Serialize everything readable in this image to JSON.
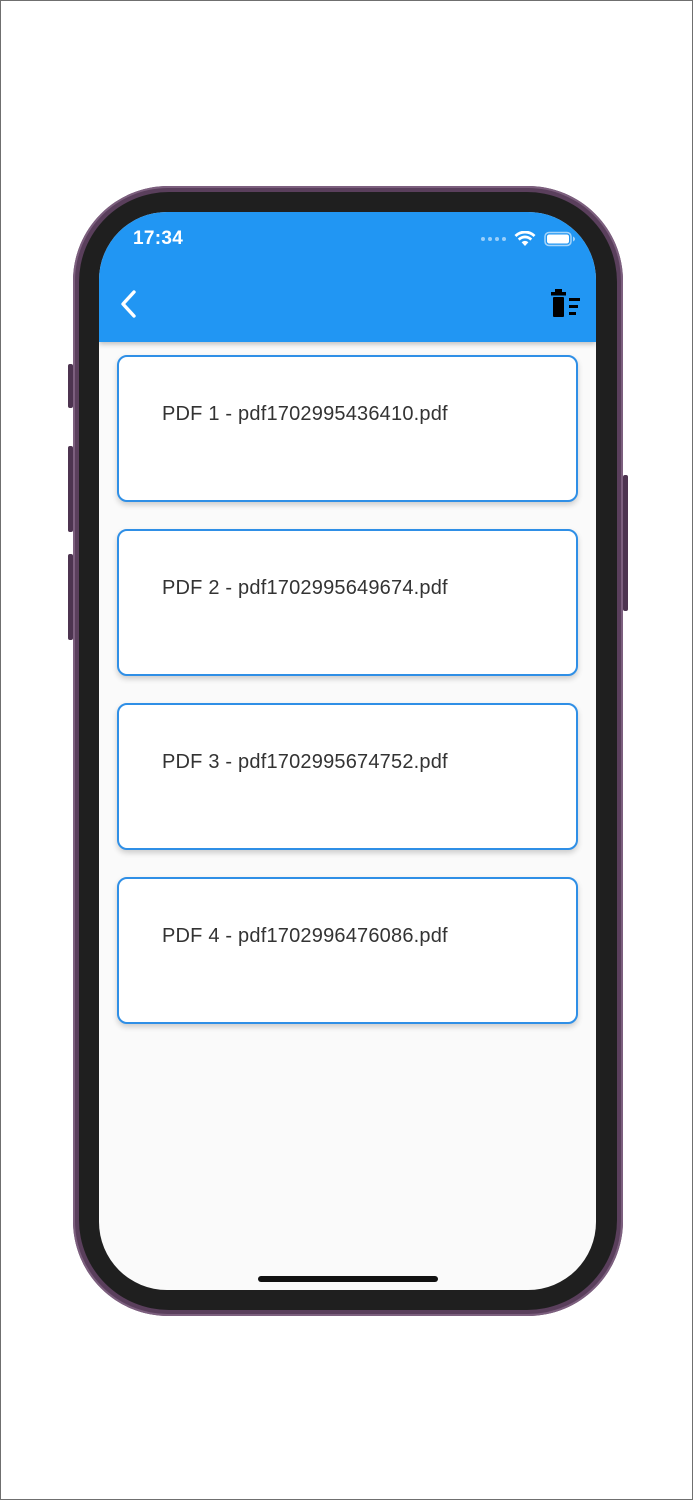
{
  "status_bar": {
    "time": "17:34"
  },
  "app_bar": {
    "back_icon": "chevron-left-icon",
    "action_icon": "delete-sweep-icon",
    "background_color": "#2196f3"
  },
  "pdf_list": [
    {
      "label": "PDF 1 - pdf1702995436410.pdf"
    },
    {
      "label": "PDF 2 - pdf1702995649674.pdf"
    },
    {
      "label": "PDF 3 - pdf1702995674752.pdf"
    },
    {
      "label": "PDF 4 - pdf1702996476086.pdf"
    }
  ],
  "colors": {
    "card_border": "#2f8fe6",
    "screen_background": "#fafafa"
  }
}
